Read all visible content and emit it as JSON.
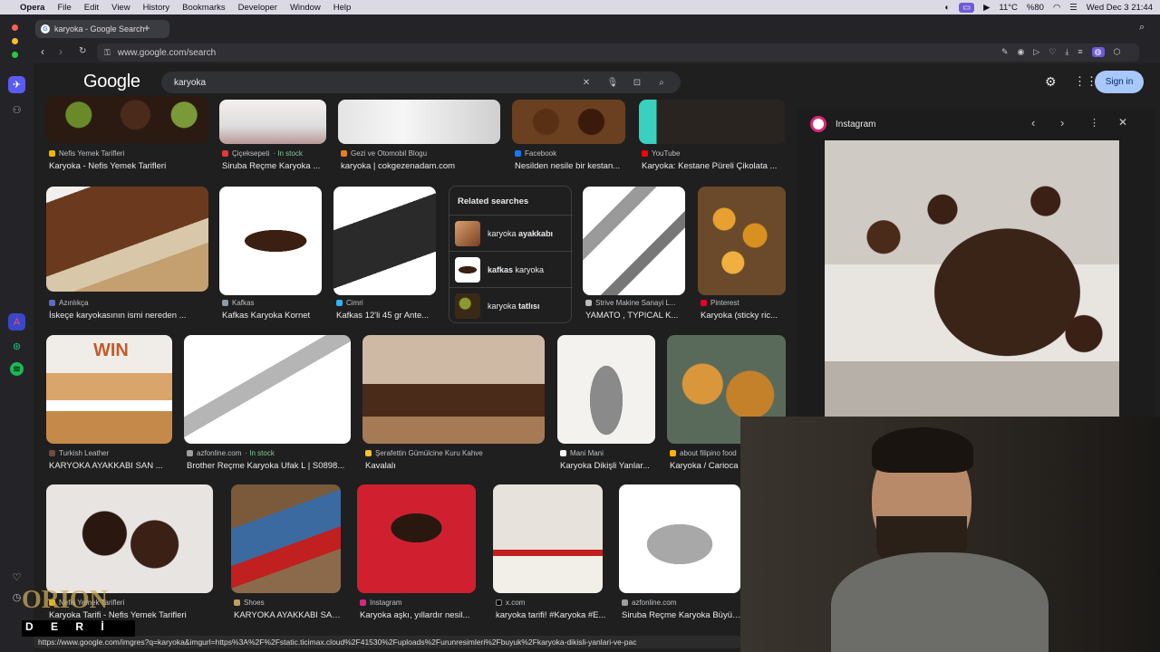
{
  "menubar": {
    "app": "Opera",
    "items": [
      "File",
      "Edit",
      "View",
      "History",
      "Bookmarks",
      "Developer",
      "Window",
      "Help"
    ],
    "weather": "11°C",
    "battery": "%80",
    "datetime": "Wed Dec 3  21:44"
  },
  "browser": {
    "tab_title": "karyoka - Google Search",
    "url": "www.google.com/search",
    "status_url": "https://www.google.com/imgres?q=karyoka&imgurl=https%3A%2F%2Fstatic.ticimax.cloud%2F41530%2Fuploads%2Furunresimleri%2Fbuyuk%2Fkaryoka-dikisli-yanlari-ve-pac"
  },
  "google": {
    "logo": "Google",
    "query": "karyoka",
    "signin": "Sign in"
  },
  "row1": [
    {
      "source": "Nefis Yemek Tarifleri",
      "title": "Karyoka - Nefis Yemek Tarifleri",
      "fav": "#f4b400"
    },
    {
      "source": "Çiçeksepeti",
      "stock": "· In stock",
      "title": "Siruba Reçme Karyoka ...",
      "fav": "#e53935"
    },
    {
      "source": "Gezi ve Otomobil Blogu",
      "title": "karyoka | cokgezenadam.com",
      "fav": "#e67e22"
    },
    {
      "source": "Facebook",
      "title": "Nesilden nesile bir kestan...",
      "fav": "#1877f2"
    },
    {
      "source": "YouTube",
      "title": "Karyoka: Kestane Püreli Çikolata ...",
      "fav": "#ff0000"
    }
  ],
  "row2": [
    {
      "source": "Azınlıkça",
      "title": "İskeçe karyokasının ismi nereden ...",
      "fav": "#5c6bc0"
    },
    {
      "source": "Kafkas",
      "title": "Kafkas Karyoka Kornet",
      "fav": "#8e9aa6"
    },
    {
      "source": "Cimri",
      "title": "Kafkas 12'li 45 gr Ante...",
      "fav": "#29b6f6"
    },
    {
      "source": "Strive Makine Sanayi L...",
      "title": "YAMATO , TYPICAL K...",
      "fav": "#bdbdbd"
    },
    {
      "source": "Pinterest",
      "title": "Karyoka (sticky ric...",
      "fav": "#e60023"
    }
  ],
  "related": {
    "heading": "Related searches",
    "items": [
      {
        "prefix": "karyoka",
        "bold": "ayakkabı",
        "order": "pb"
      },
      {
        "prefix": "kafkas",
        "bold": "karyoka",
        "order": "bp"
      },
      {
        "prefix": "karyoka",
        "bold": "tatlısı",
        "order": "pb"
      }
    ]
  },
  "row3": [
    {
      "source": "Turkish Leather",
      "title": "KARYOKA AYAKKABI SAN ...",
      "fav": "#6d4c41"
    },
    {
      "source": "azfonline.com",
      "stock": "· In stock",
      "title": "Brother Reçme Karyoka Ufak L | S0898...",
      "fav": "#9e9e9e"
    },
    {
      "source": "Şerafettin Gümülcine Kuru Kahve",
      "title": "Kavalalı",
      "fav": "#fbc02d"
    },
    {
      "source": "Mani Mani",
      "title": "Karyoka Dikişli Yanlar...",
      "fav": "#f5f5f5"
    },
    {
      "source": "about filipino food",
      "title": "Karyoka / Carioca",
      "fav": "#ffb300"
    }
  ],
  "row4": [
    {
      "source": "Nefis Yemek Tarifleri",
      "title": "Karyoka Tarifi - Nefis Yemek Tarifleri",
      "fav": "#f4b400"
    },
    {
      "source": "Shoes",
      "title": "KARYOKA AYAKKABI SAN...",
      "fav": "#c0a060"
    },
    {
      "source": "Instagram",
      "title": "Karyoka aşkı, yıllardır nesil...",
      "fav": "#d62976"
    },
    {
      "source": "x.com",
      "title": "karyoka tarifi! #Karyoka #E...",
      "fav": "#000000"
    },
    {
      "source": "azfonline.com",
      "title": "Siruba Reçme Karyoka Büyük L",
      "fav": "#9e9e9e"
    }
  ],
  "preview": {
    "source": "Instagram"
  },
  "watermark": {
    "line1": "ORION",
    "line2": "D E R İ"
  }
}
